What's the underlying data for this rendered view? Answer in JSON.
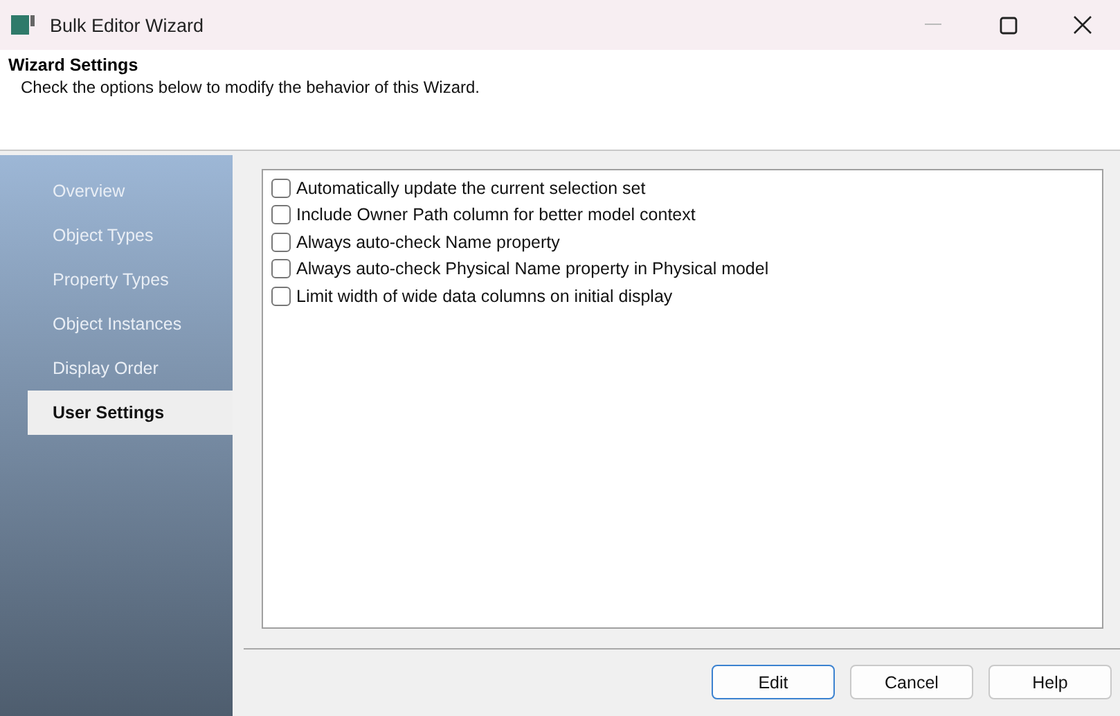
{
  "window": {
    "title": "Bulk Editor Wizard"
  },
  "header": {
    "title": "Wizard Settings",
    "description": "Check the options below to modify the behavior of this Wizard."
  },
  "sidebar": {
    "items": [
      {
        "label": "Overview",
        "selected": false
      },
      {
        "label": "Object Types",
        "selected": false
      },
      {
        "label": "Property Types",
        "selected": false
      },
      {
        "label": "Object Instances",
        "selected": false
      },
      {
        "label": "Display Order",
        "selected": false
      },
      {
        "label": "User Settings",
        "selected": true
      }
    ]
  },
  "options": [
    {
      "label": "Automatically update the current selection set",
      "checked": false
    },
    {
      "label": "Include Owner Path column for better model context",
      "checked": false
    },
    {
      "label": "Always auto-check Name property",
      "checked": false
    },
    {
      "label": "Always auto-check Physical Name property in Physical model",
      "checked": false
    },
    {
      "label": "Limit width of wide data columns on initial display",
      "checked": false
    }
  ],
  "buttons": [
    {
      "label": "Edit",
      "default": true
    },
    {
      "label": "Cancel",
      "default": false
    },
    {
      "label": "Help",
      "default": false
    }
  ]
}
